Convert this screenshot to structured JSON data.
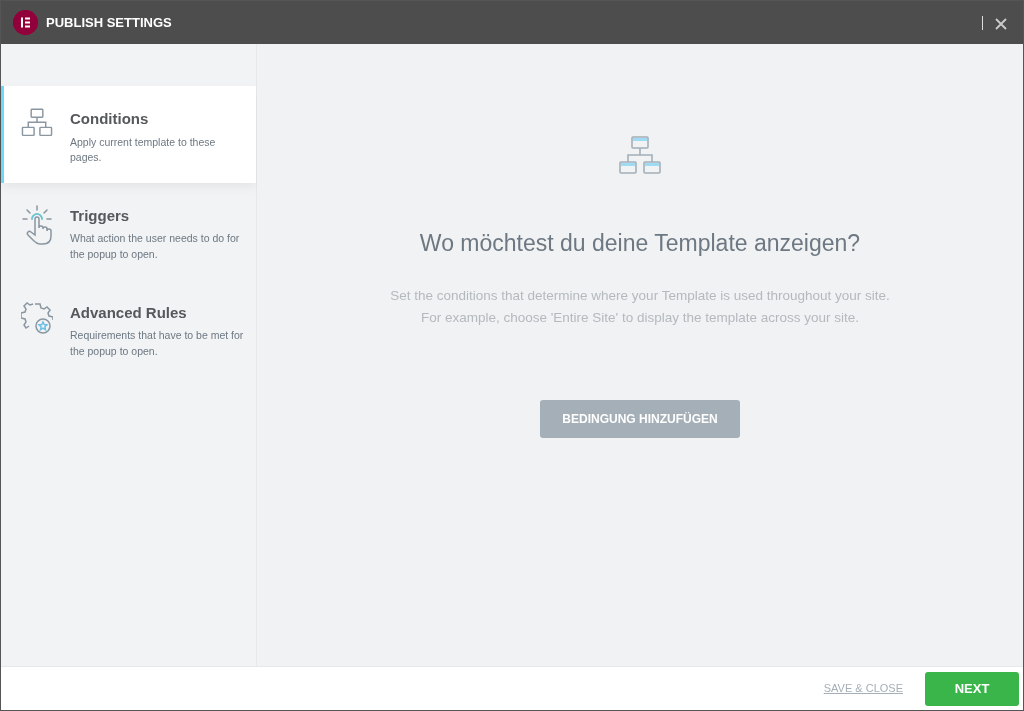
{
  "window": {
    "title": "PUBLISH SETTINGS"
  },
  "tabs": [
    {
      "kind": "conditions",
      "label": "Conditions",
      "description": "Apply current template to these pages.",
      "selected": true
    },
    {
      "kind": "triggers",
      "label": "Triggers",
      "description": "What action the user needs to do for the popup to open.",
      "selected": false
    },
    {
      "kind": "rules",
      "label": "Advanced Rules",
      "description": "Requirements that have to be met for the popup to open.",
      "selected": false
    }
  ],
  "main": {
    "heading": "Wo möchtest du deine Template anzeigen?",
    "lines": [
      "Set the conditions that determine where your Template is used throughout your site.",
      "For example, choose 'Entire Site' to display the template across your site."
    ],
    "button": "BEDINGUNG HINZUFÜGEN"
  },
  "footer": {
    "link": "SAVE & CLOSE",
    "button": "NEXT"
  }
}
